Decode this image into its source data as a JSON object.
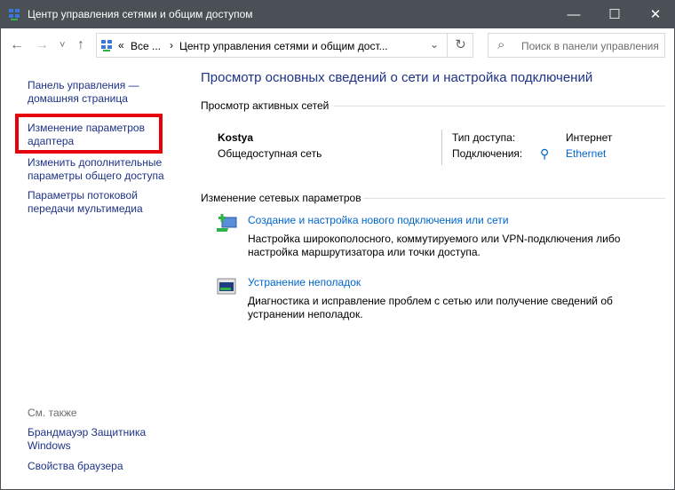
{
  "window": {
    "title": "Центр управления сетями и общим доступом",
    "minimize": "—",
    "maximize": "☐",
    "close": "✕"
  },
  "nav": {
    "back": "←",
    "forward": "→",
    "recent": "˅",
    "up": "↑",
    "breadcrumb_prefix": "«",
    "crumb1": "Все ...",
    "sep": "›",
    "crumb2": "Центр управления сетями и общим дост...",
    "dropdown": "⌄",
    "refresh": "↻",
    "search_icon": "⌕",
    "search_placeholder": "Поиск в панели управления"
  },
  "sidebar": {
    "items": [
      {
        "label1": "Панель управления —",
        "label2": "домашняя страница"
      },
      {
        "label1": "Изменение параметров",
        "label2": "адаптера"
      },
      {
        "label1": "Изменить дополнительные",
        "label2": "параметры общего доступа"
      },
      {
        "label1": "Параметры потоковой",
        "label2": "передачи мультимедиа"
      }
    ],
    "see_also": "См. также",
    "see_items": [
      {
        "label1": "Брандмауэр Защитника",
        "label2": "Windows"
      },
      {
        "label1": "Свойства браузера"
      }
    ]
  },
  "main": {
    "title": "Просмотр основных сведений о сети и настройка подключений",
    "active_heading": "Просмотр активных сетей",
    "network": {
      "name": "Kostya",
      "type": "Общедоступная сеть",
      "access_label": "Тип доступа:",
      "access_value": "Интернет",
      "conn_label": "Подключения:",
      "conn_value": "Ethernet"
    },
    "change_heading": "Изменение сетевых параметров",
    "tasks": [
      {
        "link": "Создание и настройка нового подключения или сети",
        "desc1": "Настройка широкополосного, коммутируемого или VPN-подключения либо",
        "desc2": "настройка маршрутизатора или точки доступа."
      },
      {
        "link": "Устранение неполадок",
        "desc1": "Диагностика и исправление проблем с сетью или получение сведений об",
        "desc2": "устранении неполадок."
      }
    ]
  },
  "colors": {
    "titlebar": "#4a5055",
    "highlight": "#e8000b",
    "link": "#0066cc",
    "nav": "#1e3287"
  }
}
